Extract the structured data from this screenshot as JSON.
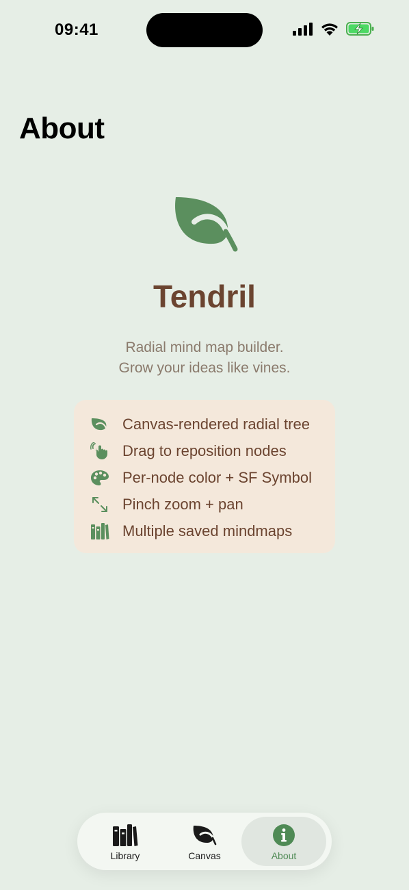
{
  "status_bar": {
    "time": "09:41",
    "icons": [
      "cellular-signal-icon",
      "wifi-icon",
      "battery-charging-icon"
    ]
  },
  "page": {
    "title": "About"
  },
  "app": {
    "logo_icon": "leaf-icon",
    "name": "Tendril",
    "tagline_lines": [
      "Radial mind map builder.",
      "Grow your ideas like vines."
    ]
  },
  "features": [
    {
      "icon": "leaf-icon",
      "label": "Canvas-rendered radial tree"
    },
    {
      "icon": "hand-drag-icon",
      "label": "Drag to reposition nodes"
    },
    {
      "icon": "palette-icon",
      "label": "Per-node color + SF Symbol"
    },
    {
      "icon": "arrows-expand-icon",
      "label": "Pinch zoom + pan"
    },
    {
      "icon": "books-icon",
      "label": "Multiple saved mindmaps"
    }
  ],
  "tab_bar": {
    "tabs": [
      {
        "label": "Library",
        "icon": "books-icon",
        "active": false
      },
      {
        "label": "Canvas",
        "icon": "leaf-icon",
        "active": false
      },
      {
        "label": "About",
        "icon": "info-icon",
        "active": true
      }
    ]
  },
  "colors": {
    "background": "#e6eee6",
    "accent_green": "#5b8f5e",
    "brown": "#6b4430",
    "card": "#f4e8db",
    "muted_text": "#8a7a6c"
  }
}
